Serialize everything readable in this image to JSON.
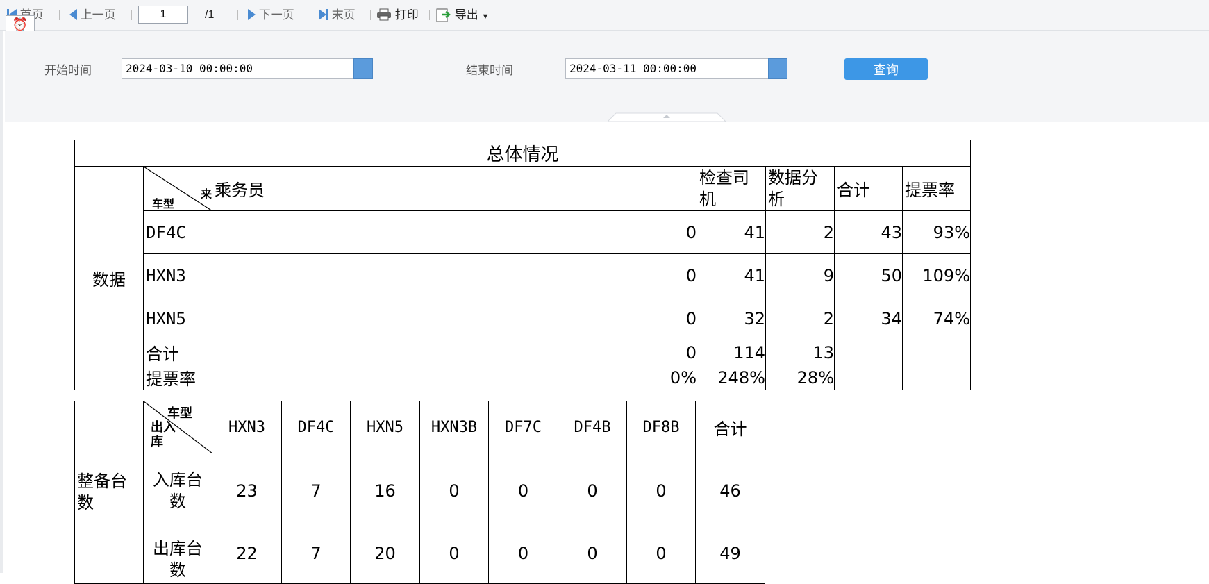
{
  "toolbar": {
    "first_label": "首页",
    "prev_label": "上一页",
    "page_value": "1",
    "page_total": "/1",
    "next_label": "下一页",
    "last_label": "末页",
    "print_label": "打印",
    "export_label": "导出"
  },
  "filter": {
    "start_label": "开始时间",
    "start_value": "2024-03-10 00:00:00",
    "end_label": "结束时间",
    "end_value": "2024-03-11 00:00:00",
    "query_label": "查询"
  },
  "colors": {
    "accent": "#3d97e6",
    "nav_icon": "#4a8bd2",
    "toolbar_bg": "#f4f5f7"
  },
  "table1": {
    "title": "总体情况",
    "side_label": "数据",
    "diag_top": "来",
    "diag_bottom": "车型",
    "columns": [
      "乘务员",
      "检查司机",
      "数据分析",
      "合计",
      "提票率"
    ],
    "rows": [
      {
        "type": "DF4C",
        "values": [
          "0",
          "41",
          "2",
          "43",
          "93%"
        ]
      },
      {
        "type": "HXN3",
        "values": [
          "0",
          "41",
          "9",
          "50",
          "109%"
        ]
      },
      {
        "type": "HXN5",
        "values": [
          "0",
          "32",
          "2",
          "34",
          "74%"
        ]
      }
    ],
    "total_row": {
      "label": "合计",
      "values": [
        "0",
        "114",
        "13",
        "",
        ""
      ]
    },
    "rate_row": {
      "label": "提票率",
      "values": [
        "0%",
        "248%",
        "28%",
        "",
        ""
      ]
    }
  },
  "table2": {
    "side_label": "整备台数",
    "diag_top": "车型",
    "diag_bottom": "出入库",
    "columns": [
      "HXN3",
      "DF4C",
      "HXN5",
      "HXN3B",
      "DF7C",
      "DF4B",
      "DF8B",
      "合计"
    ],
    "rows": [
      {
        "label": "入库台数",
        "values": [
          "23",
          "7",
          "16",
          "0",
          "0",
          "0",
          "0",
          "46"
        ]
      },
      {
        "label": "出库台数",
        "values": [
          "22",
          "7",
          "20",
          "0",
          "0",
          "0",
          "0",
          "49"
        ]
      }
    ]
  }
}
